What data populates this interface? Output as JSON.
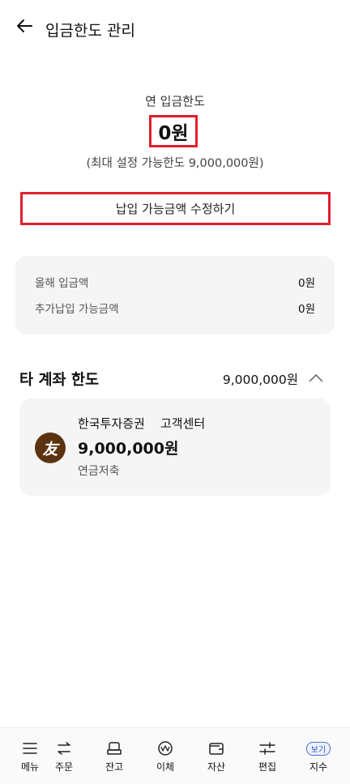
{
  "header": {
    "title": "입금한도 관리",
    "back_icon": "arrow-left-icon"
  },
  "limit": {
    "label": "연 입금한도",
    "value": "0원",
    "max_note": "(최대 설정 가능한도 9,000,000원)",
    "edit_button": "납입 가능금액 수정하기"
  },
  "summary": {
    "rows": [
      {
        "label": "올해 입금액",
        "value": "0원"
      },
      {
        "label": "추가납입 가능금액",
        "value": "0원"
      }
    ]
  },
  "other_accounts": {
    "title": "타 계좌 한도",
    "total": "9,000,000원",
    "accounts": [
      {
        "logo_text": "友",
        "logo_color": "#5c3310",
        "firm": "한국투자증권",
        "center": "고객센터",
        "amount": "9,000,000원",
        "type": "연금저축"
      }
    ]
  },
  "bottom_nav": {
    "items": [
      {
        "label": "메뉴",
        "icon": "menu-icon"
      },
      {
        "label": "주문",
        "icon": "swap-arrows-icon"
      },
      {
        "label": "잔고",
        "icon": "balance-tray-icon"
      },
      {
        "label": "이체",
        "icon": "transfer-won-icon"
      },
      {
        "label": "자산",
        "icon": "wallet-icon"
      },
      {
        "label": "편집",
        "icon": "sliders-icon"
      },
      {
        "label": "지수",
        "icon": "view-badge",
        "badge": "보기"
      }
    ]
  },
  "colors": {
    "highlight_border": "#e01e2e",
    "card_bg": "#f5f5f5",
    "badge_blue": "#2d57c8"
  }
}
